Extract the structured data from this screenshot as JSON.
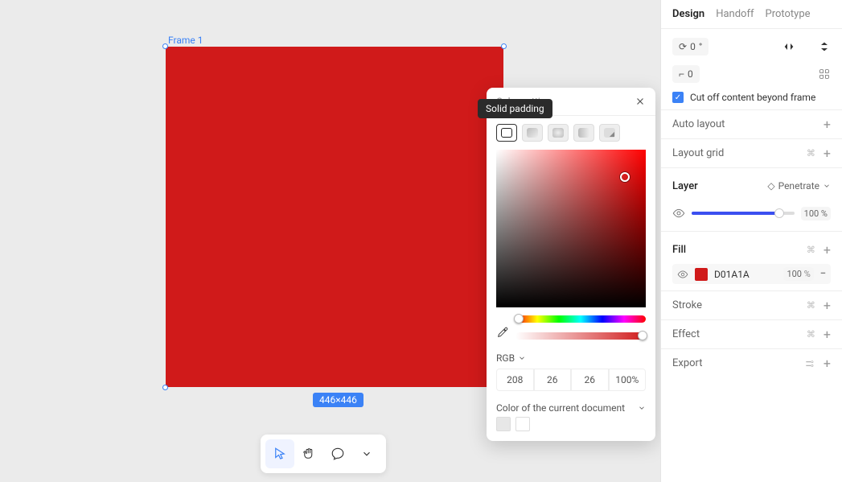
{
  "canvas": {
    "frame_label": "Frame 1",
    "dimensions": "446×446",
    "frame_fill": "#D01A1A"
  },
  "tooltip": {
    "text": "Solid padding"
  },
  "popover": {
    "title": "Color setting",
    "mode": "RGB",
    "rgb": {
      "r": "208",
      "g": "26",
      "b": "26",
      "a": "100%"
    },
    "doc_label": "Color of the current document"
  },
  "sidebar": {
    "tabs": {
      "design": "Design",
      "handoff": "Handoff",
      "prototype": "Prototype"
    },
    "rotation": "0",
    "radius": "0",
    "clip_label": "Cut off content beyond frame",
    "sections": {
      "auto_layout": "Auto layout",
      "layout_grid": "Layout grid",
      "layer": "Layer",
      "layer_mode": "Penetrate",
      "layer_opacity": "100",
      "fill": "Fill",
      "fill_hex": "D01A1A",
      "fill_opacity": "100",
      "stroke": "Stroke",
      "effect": "Effect",
      "export": "Export"
    }
  }
}
